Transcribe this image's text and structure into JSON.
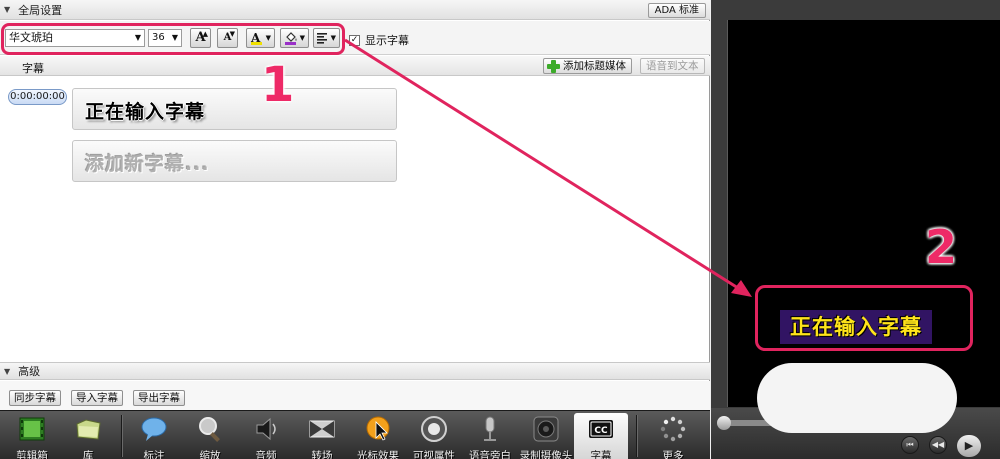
{
  "global_settings": {
    "title": "全局设置",
    "ada_button": "ADA 标准"
  },
  "toolbar": {
    "font": "华文琥珀",
    "size": "36",
    "grow_font": "A",
    "shrink_font": "A",
    "text_color": "A",
    "show_captions_label": "显示字幕",
    "show_captions_checked": "✓"
  },
  "captions": {
    "header": "字幕",
    "add_media_button": "添加标题媒体",
    "speech_to_text_button": "语音到文本",
    "items": [
      {
        "time": "0:00:00:00",
        "text": "正在输入字幕"
      }
    ],
    "add_new_placeholder": "添加新字幕..."
  },
  "advanced": {
    "title": "高级",
    "sync_button": "同步字幕",
    "import_button": "导入字幕",
    "export_button": "导出字幕"
  },
  "dock": {
    "items": [
      {
        "label": "剪辑箱",
        "icon": "film-clip-icon"
      },
      {
        "label": "库",
        "icon": "library-folder-icon"
      },
      {
        "label": "标注",
        "icon": "speech-bubble-icon"
      },
      {
        "label": "缩放",
        "icon": "magnifier-icon"
      },
      {
        "label": "音频",
        "icon": "speaker-icon"
      },
      {
        "label": "转场",
        "icon": "transition-icon"
      },
      {
        "label": "光标效果",
        "icon": "cursor-effect-icon"
      },
      {
        "label": "可视属性",
        "icon": "visual-properties-icon"
      },
      {
        "label": "语音旁白",
        "icon": "microphone-icon"
      },
      {
        "label": "录制摄像头",
        "icon": "webcam-icon"
      },
      {
        "label": "字幕",
        "icon": "cc-icon"
      },
      {
        "label": "更多",
        "icon": "more-icon"
      }
    ]
  },
  "preview": {
    "caption_text": "正在输入字幕",
    "play_symbol": "▶",
    "prev_symbol": "⏮",
    "rewind_symbol": "◀◀"
  },
  "annotations": {
    "marker_1": "1",
    "marker_2": "2"
  },
  "colors": {
    "annotation": "#e0245e",
    "caption_bg": "#311463",
    "caption_fg": "#ffe41a"
  }
}
